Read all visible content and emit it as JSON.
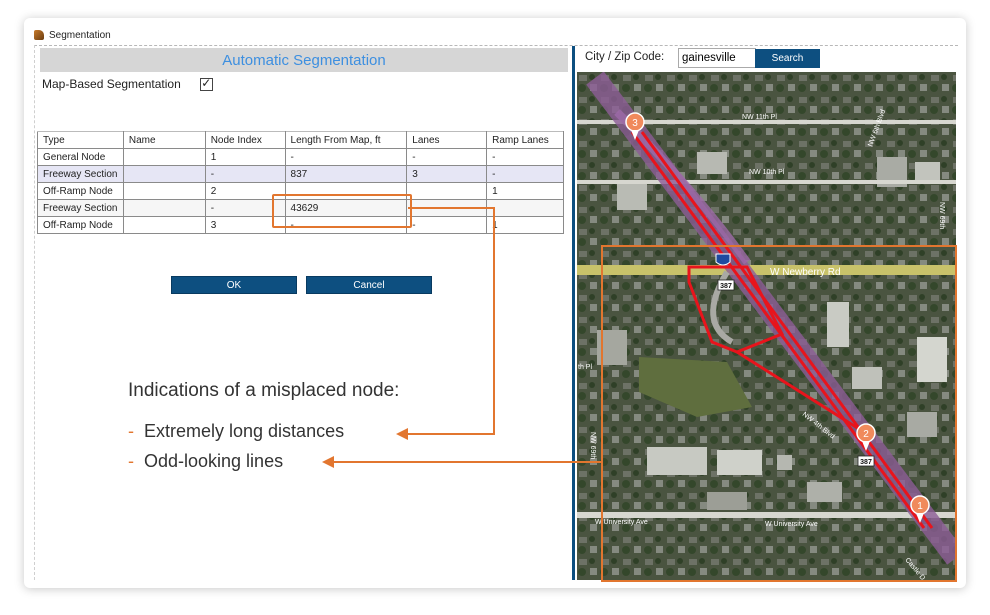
{
  "window": {
    "title": "Segmentation"
  },
  "header": {
    "title": "Automatic Segmentation"
  },
  "map_based": {
    "label": "Map-Based Segmentation",
    "checked_mark": "✓"
  },
  "table": {
    "columns": [
      "Type",
      "Name",
      "Node Index",
      "Length From Map, ft",
      "Lanes",
      "Ramp Lanes"
    ],
    "rows": [
      [
        "General Node",
        "",
        "1",
        "-",
        "-",
        "-"
      ],
      [
        "Freeway Section",
        "",
        "-",
        "837",
        "3",
        "-"
      ],
      [
        "Off-Ramp Node",
        "",
        "2",
        "",
        "",
        "1"
      ],
      [
        "Freeway Section",
        "",
        "-",
        "43629",
        "",
        "-"
      ],
      [
        "Off-Ramp Node",
        "",
        "3",
        "-",
        "-",
        "1"
      ]
    ]
  },
  "buttons": {
    "ok": "OK",
    "cancel": "Cancel"
  },
  "search": {
    "label": "City / Zip Code:",
    "value": "gainesville",
    "button": "Search"
  },
  "annotation": {
    "title": "Indications of a misplaced node:",
    "bullets": [
      "Extremely long distances",
      "Odd-looking lines"
    ],
    "dash": "-",
    "accent": "#e2762f"
  },
  "map": {
    "labels": {
      "nw11": "NW 11th Pl",
      "nw10": "NW 10th Pl",
      "newberry": "W Newberry Rd",
      "nw4": "NW 4th Blvd",
      "university_l": "W University Ave",
      "university_r": "W University Ave",
      "th_pl": "th Pl",
      "nw6_blvd": "NW 6th Blvd",
      "nw69": "NW 69th",
      "nw69_left": "NW 69th",
      "castle": "Castle D",
      "shield1": "387",
      "shield2": "387"
    },
    "markers": [
      "1",
      "2",
      "3"
    ]
  },
  "colors": {
    "accent": "#e2762f",
    "button": "#0d4f80",
    "header_text": "#3d8fe0",
    "route": "#e8141c"
  }
}
